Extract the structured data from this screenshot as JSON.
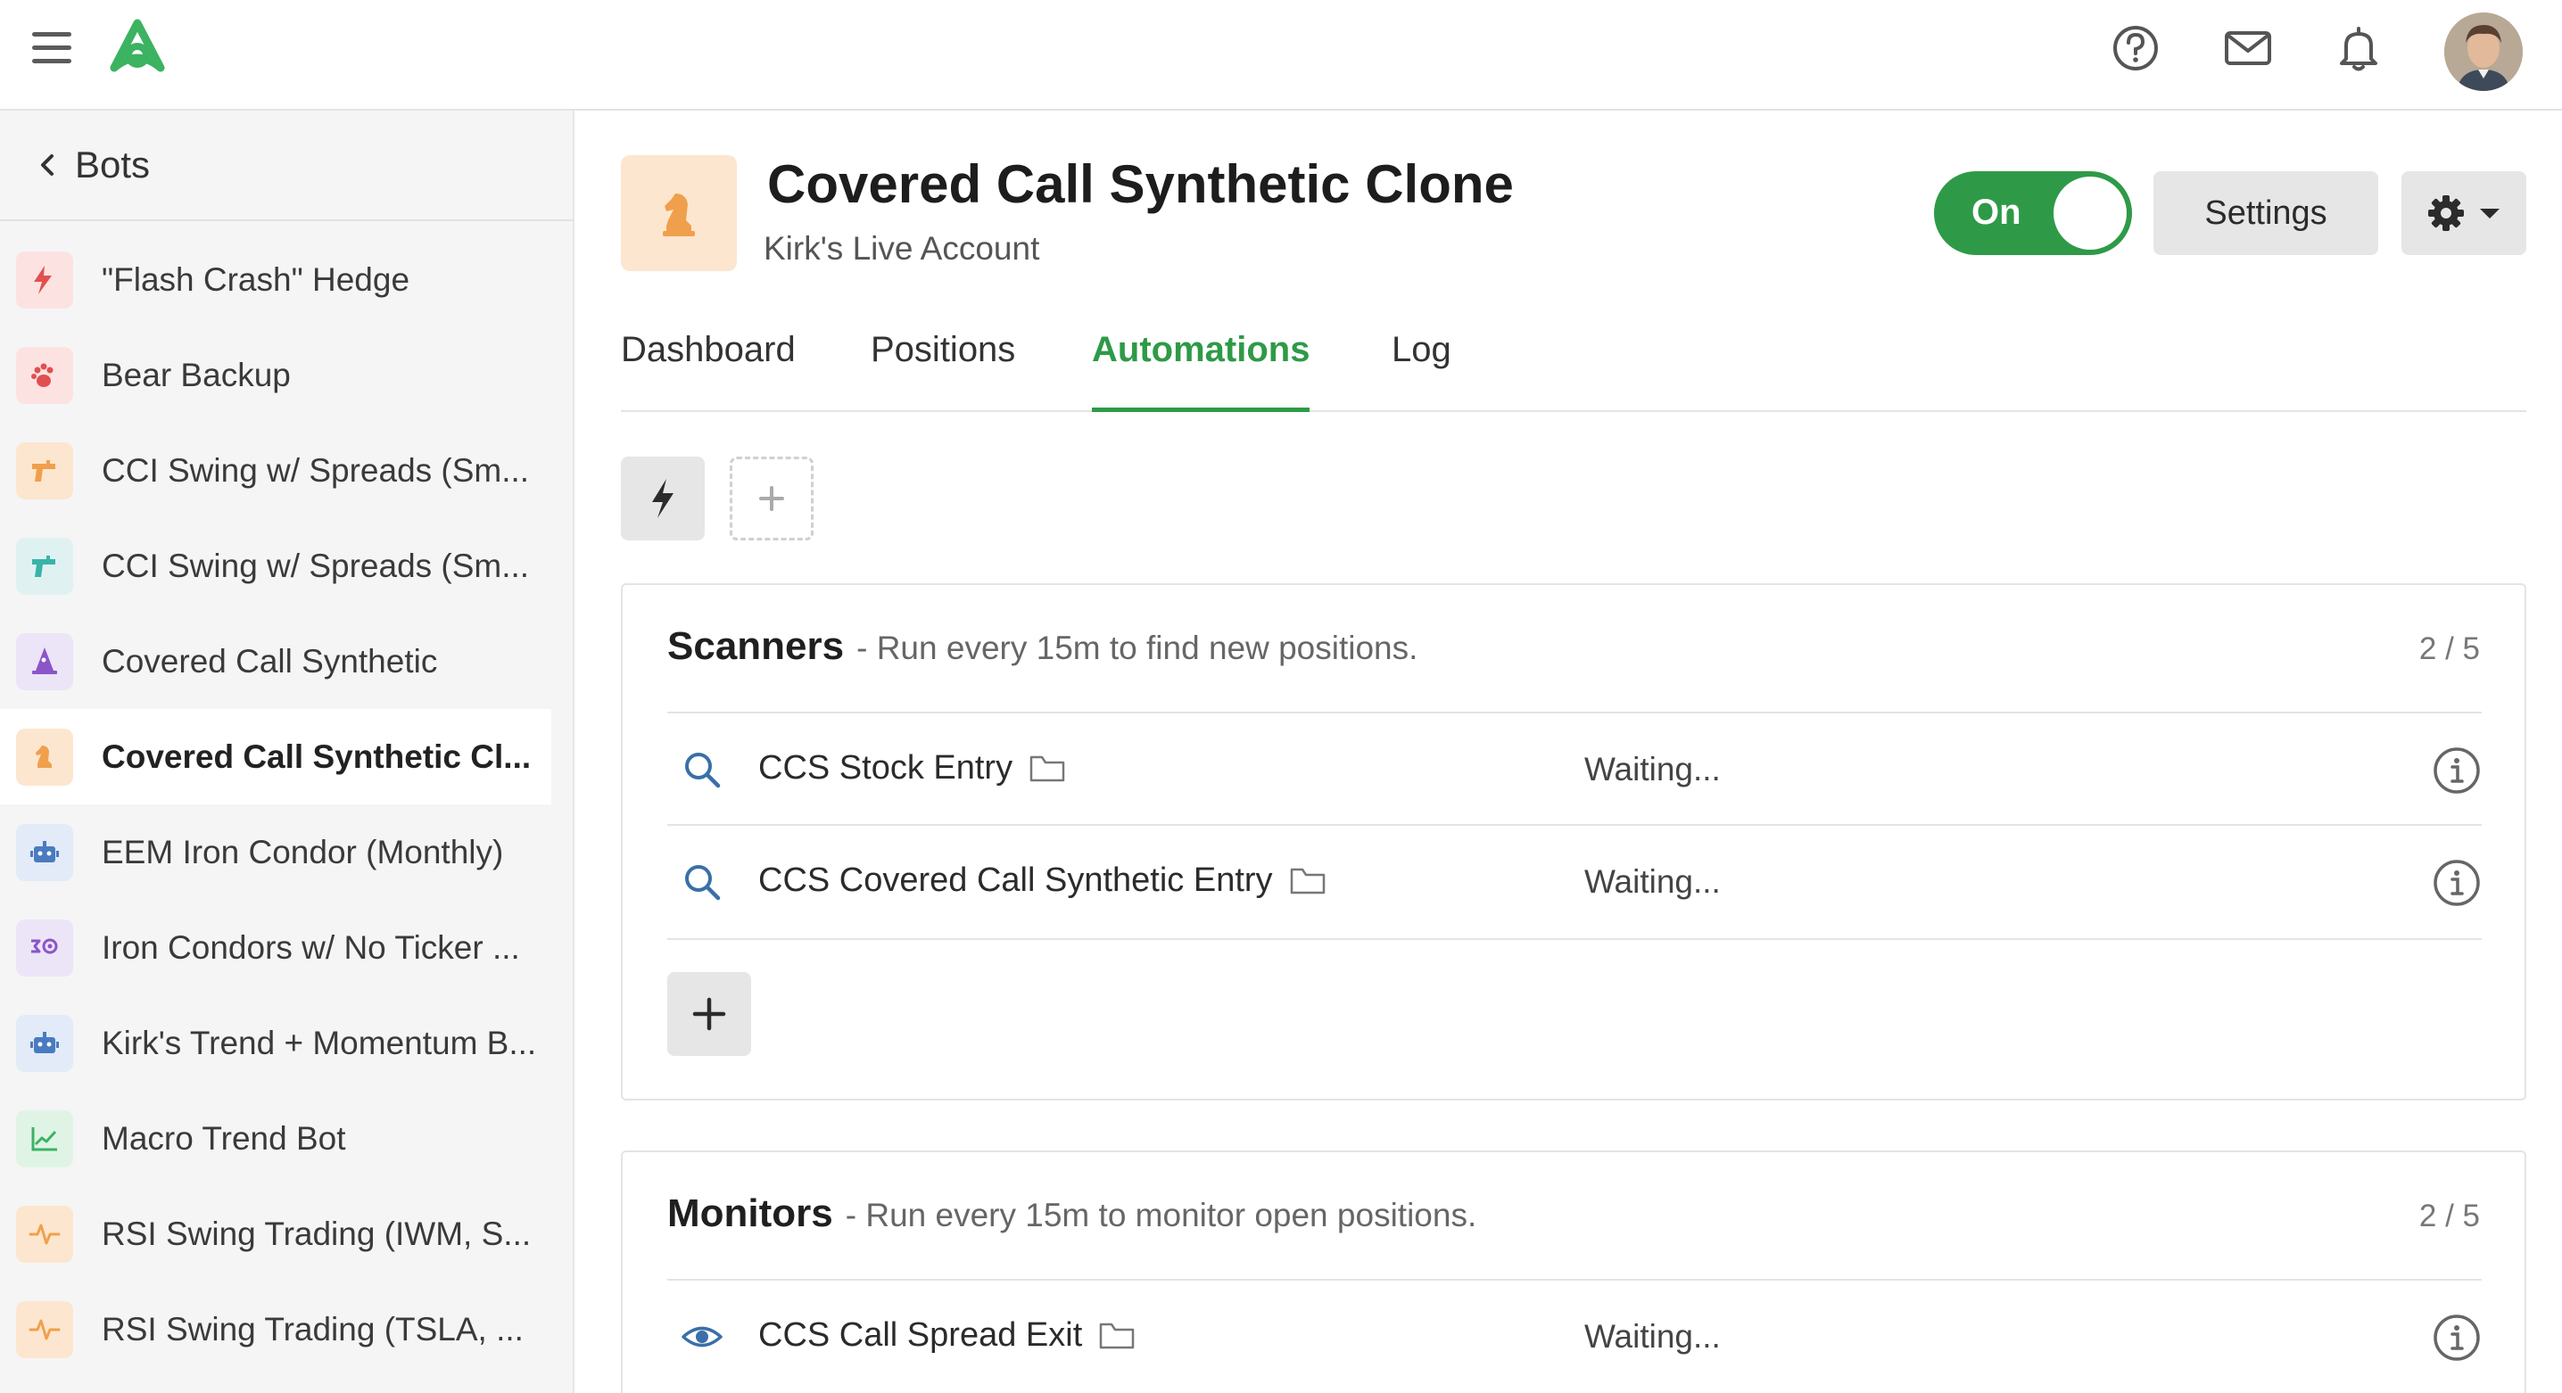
{
  "header": {
    "logo_name": "triangle-logo",
    "brand_color": "#2e9a47",
    "icons": [
      "menu-icon",
      "help-icon",
      "mail-icon",
      "bell-icon"
    ]
  },
  "sidebar": {
    "back_label": "Bots",
    "items": [
      {
        "label": "\"Flash Crash\" Hedge",
        "icon": "lightning-icon",
        "bg": "#fde2e2",
        "color": "#e05050"
      },
      {
        "label": "Bear Backup",
        "icon": "paw-icon",
        "bg": "#fde2e2",
        "color": "#e05050"
      },
      {
        "label": "CCI Swing w/ Spreads (Sm...",
        "icon": "gun-icon",
        "bg": "#fde6cf",
        "color": "#f0a04c"
      },
      {
        "label": "CCI Swing w/ Spreads (Sm...",
        "icon": "gun-icon",
        "bg": "#dff2f1",
        "color": "#3ab3a8"
      },
      {
        "label": "Covered Call Synthetic",
        "icon": "wizard-hat-icon",
        "bg": "#ece4f7",
        "color": "#8a55c9"
      },
      {
        "label": "Covered Call Synthetic Cl...",
        "icon": "chess-knight-icon",
        "bg": "#fde6cf",
        "color": "#f0a04c",
        "active": true
      },
      {
        "label": "EEM Iron Condor (Monthly)",
        "icon": "robot-icon",
        "bg": "#e2ebf7",
        "color": "#4a7bc0"
      },
      {
        "label": "Iron Condors w/ No Ticker ...",
        "icon": "condor-icon",
        "bg": "#ece4f7",
        "color": "#8a55c9"
      },
      {
        "label": "Kirk's Trend + Momentum B...",
        "icon": "robot-icon",
        "bg": "#e2ebf7",
        "color": "#4a7bc0"
      },
      {
        "label": "Macro Trend Bot",
        "icon": "chart-icon",
        "bg": "#e0f4e6",
        "color": "#3bb360"
      },
      {
        "label": "RSI Swing Trading (IWM, S...",
        "icon": "pulse-icon",
        "bg": "#fde6cf",
        "color": "#f0a04c"
      },
      {
        "label": "RSI Swing Trading (TSLA, ...",
        "icon": "pulse-icon",
        "bg": "#fde6cf",
        "color": "#f0a04c"
      }
    ]
  },
  "bot": {
    "title": "Covered Call Synthetic Clone",
    "subtitle": "Kirk's Live Account",
    "icon": "chess-knight-icon",
    "toggle_label": "On",
    "settings_label": "Settings"
  },
  "tabs": [
    {
      "label": "Dashboard",
      "active": false
    },
    {
      "label": "Positions",
      "active": false
    },
    {
      "label": "Automations",
      "active": true
    },
    {
      "label": "Log",
      "active": false
    }
  ],
  "scanners": {
    "title": "Scanners",
    "desc": "- Run every 15m to find new positions.",
    "count": "2 / 5",
    "rows": [
      {
        "name": "CCS Stock Entry",
        "status": "Waiting...",
        "icon": "search-icon"
      },
      {
        "name": "CCS Covered Call Synthetic Entry",
        "status": "Waiting...",
        "icon": "search-icon"
      }
    ]
  },
  "monitors": {
    "title": "Monitors",
    "desc": "- Run every 15m to monitor open positions.",
    "count": "2 / 5",
    "rows": [
      {
        "name": "CCS Call Spread Exit",
        "status": "Waiting...",
        "icon": "eye-icon"
      }
    ]
  }
}
